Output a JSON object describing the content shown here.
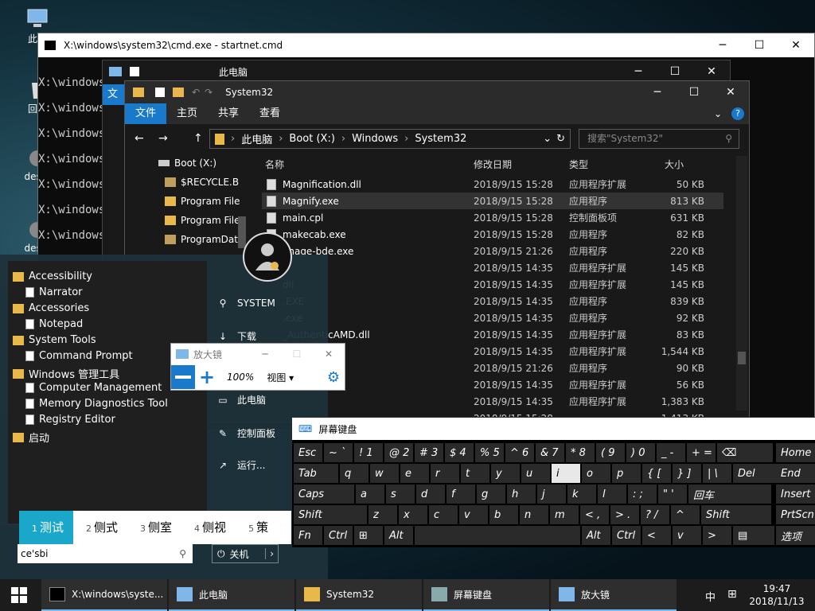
{
  "desktop": {
    "icons": [
      "此电",
      "回收",
      "deskt",
      "deskt"
    ]
  },
  "cmd": {
    "title": "X:\\windows\\system32\\cmd.exe - startnet.cmd",
    "prompt": "X:\\windows\\"
  },
  "explorer_back": {
    "title": "此电脑",
    "tab": "文"
  },
  "explorer": {
    "title": "System32",
    "tabs": [
      "文件",
      "主页",
      "共享",
      "查看"
    ],
    "breadcrumb": [
      "此电脑",
      "Boot (X:)",
      "Windows",
      "System32"
    ],
    "search_placeholder": "搜索\"System32\"",
    "columns": {
      "name": "名称",
      "date": "修改日期",
      "type": "类型",
      "size": "大小"
    },
    "nav": [
      "Boot (X:)",
      "$RECYCLE.B",
      "Program File",
      "Program File",
      "ProgramDat"
    ],
    "files": [
      {
        "name": "Magnification.dll",
        "date": "2018/9/15 15:28",
        "type": "应用程序扩展",
        "size": "50 KB"
      },
      {
        "name": "Magnify.exe",
        "date": "2018/9/15 15:28",
        "type": "应用程序",
        "size": "813 KB"
      },
      {
        "name": "main.cpl",
        "date": "2018/9/15 15:28",
        "type": "控制面板项",
        "size": "631 KB"
      },
      {
        "name": "makecab.exe",
        "date": "2018/9/15 15:28",
        "type": "应用程序",
        "size": "82 KB"
      },
      {
        "name": "anage-bde.exe",
        "date": "2018/9/15 21:26",
        "type": "应用程序",
        "size": "220 KB"
      },
      {
        "name": "l",
        "date": "2018/9/15 14:35",
        "type": "应用程序扩展",
        "size": "145 KB"
      },
      {
        "name": "dll",
        "date": "2018/9/15 14:35",
        "type": "应用程序扩展",
        "size": "145 KB"
      },
      {
        "name": ".EXE",
        "date": "2018/9/15 14:35",
        "type": "应用程序",
        "size": "839 KB"
      },
      {
        "name": ".exe",
        "date": "2018/9/15 14:35",
        "type": "应用程序",
        "size": "92 KB"
      },
      {
        "name": "_AuthenticAMD.dll",
        "date": "2018/9/15 14:35",
        "type": "应用程序扩展",
        "size": "83 KB"
      },
      {
        "name": "nuineIntel.dll",
        "date": "2018/9/15 14:35",
        "type": "应用程序扩展",
        "size": "1,544 KB"
      },
      {
        "name": "",
        "date": "2018/9/15 21:26",
        "type": "应用程序",
        "size": "90 KB"
      },
      {
        "name": "",
        "date": "2018/9/15 14:35",
        "type": "应用程序扩展",
        "size": "56 KB"
      },
      {
        "name": "",
        "date": "2018/9/15 14:35",
        "type": "应用程序扩展",
        "size": "1,383 KB"
      },
      {
        "name": "",
        "date": "2018/9/15 15:28",
        "type": "",
        "size": "1,413 KB"
      }
    ]
  },
  "start": {
    "items": [
      {
        "label": "Accessibility",
        "kind": "folder"
      },
      {
        "label": "Narrator",
        "kind": "doc"
      },
      {
        "label": "Accessories",
        "kind": "folder"
      },
      {
        "label": "Notepad",
        "kind": "doc"
      },
      {
        "label": "System Tools",
        "kind": "folder"
      },
      {
        "label": "Command Prompt",
        "kind": "doc"
      },
      {
        "label": "Windows 管理工具",
        "kind": "folder"
      },
      {
        "label": "Computer Management",
        "kind": "doc"
      },
      {
        "label": "Memory Diagnostics Tool",
        "kind": "doc"
      },
      {
        "label": "Registry Editor",
        "kind": "doc"
      },
      {
        "label": "启动",
        "kind": "folder"
      }
    ],
    "right": [
      "SYSTEM",
      "下载",
      "此电脑",
      "控制面板",
      "运行..."
    ],
    "shutdown": "关机",
    "search_value": "ce'sbi"
  },
  "ime": {
    "candidates": [
      {
        "n": "1",
        "t": "测试"
      },
      {
        "n": "2",
        "t": "侧式"
      },
      {
        "n": "3",
        "t": "侧室"
      },
      {
        "n": "4",
        "t": "侧视"
      },
      {
        "n": "5",
        "t": "策"
      }
    ]
  },
  "magnifier": {
    "title": "放大镜",
    "zoom": "100%",
    "view": "视图"
  },
  "osk": {
    "title": "屏幕键盘",
    "rows": [
      [
        "Esc",
        "~ `",
        "! 1",
        "@ 2",
        "# 3",
        "$ 4",
        "% 5",
        "^ 6",
        "& 7",
        "* 8",
        "( 9",
        ") 0",
        "_ -",
        "+ =",
        "⌫",
        "Home"
      ],
      [
        "Tab",
        "q",
        "w",
        "e",
        "r",
        "t",
        "y",
        "u",
        "i",
        "o",
        "p",
        "{ [",
        "} ]",
        "| \\",
        "Del",
        "End"
      ],
      [
        "Caps",
        "a",
        "s",
        "d",
        "f",
        "g",
        "h",
        "j",
        "k",
        "l",
        ": ;",
        "\" '",
        "回车",
        "Insert"
      ],
      [
        "Shift",
        "z",
        "x",
        "c",
        "v",
        "b",
        "n",
        "m",
        "< ,",
        "> .",
        "? /",
        "^",
        "Shift",
        "PrtScn"
      ],
      [
        "Fn",
        "Ctrl",
        "⊞",
        "Alt",
        "",
        "Alt",
        "Ctrl",
        "<",
        "v",
        ">",
        "▤",
        "选项"
      ]
    ]
  },
  "taskbar": {
    "items": [
      "X:\\windows\\syste...",
      "此电脑",
      "System32",
      "屏幕键盘",
      "放大镜"
    ],
    "ime": "中",
    "time": "19:47",
    "date": "2018/11/13"
  }
}
